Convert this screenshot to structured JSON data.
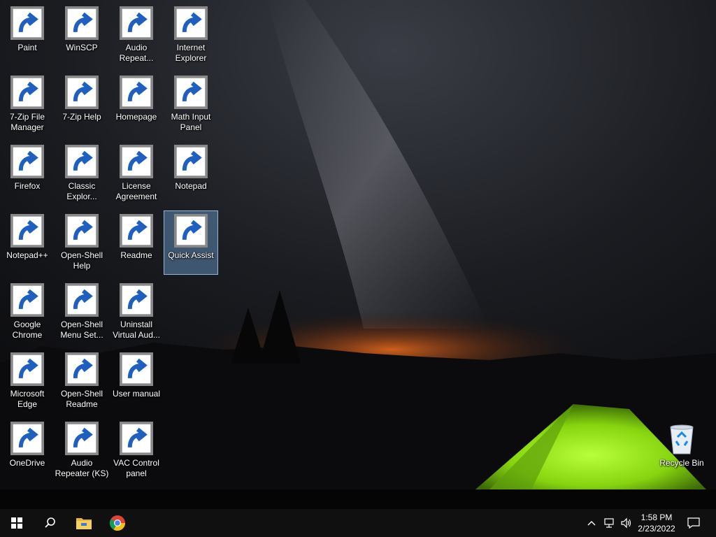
{
  "desktop": {
    "icons": [
      {
        "label": "Paint",
        "icon": "paint-icon"
      },
      {
        "label": "WinSCP",
        "icon": "winscp-icon"
      },
      {
        "label": "Audio\nRepeat...",
        "icon": "audio-repeater-icon"
      },
      {
        "label": "Internet\nExplorer",
        "icon": "internet-explorer-icon"
      },
      {
        "label": "7-Zip File\nManager",
        "icon": "7zip-icon"
      },
      {
        "label": "7-Zip Help",
        "icon": "help-icon"
      },
      {
        "label": "Homepage",
        "icon": "document-icon"
      },
      {
        "label": "Math Input\nPanel",
        "icon": "math-input-icon"
      },
      {
        "label": "Firefox",
        "icon": "firefox-icon"
      },
      {
        "label": "Classic\nExplor...",
        "icon": "shell-icon"
      },
      {
        "label": "License\nAgreement",
        "icon": "text-document-icon"
      },
      {
        "label": "Notepad",
        "icon": "notepad-icon"
      },
      {
        "label": "Notepad++",
        "icon": "notepad-plus-icon"
      },
      {
        "label": "Open-Shell\nHelp",
        "icon": "help-icon"
      },
      {
        "label": "Readme",
        "icon": "text-document-icon"
      },
      {
        "label": "Quick Assist",
        "icon": "quick-assist-icon"
      },
      {
        "label": "Google\nChrome",
        "icon": "chrome-icon"
      },
      {
        "label": "Open-Shell\nMenu Set...",
        "icon": "shell-icon"
      },
      {
        "label": "Uninstall\nVirtual Aud...",
        "icon": "uninstall-icon"
      },
      {
        "label": "Microsoft\nEdge",
        "icon": "edge-icon"
      },
      {
        "label": "Open-Shell\nReadme",
        "icon": "wordpad-doc-icon"
      },
      {
        "label": "User manual",
        "icon": "help-icon"
      },
      {
        "label": "OneDrive",
        "icon": "onedrive-icon"
      },
      {
        "label": "Audio\nRepeater (KS)",
        "icon": "audio-repeater-icon"
      },
      {
        "label": "VAC Control\npanel",
        "icon": "vac-panel-icon"
      },
      {
        "label": "Recycle Bin",
        "icon": "recycle-bin-icon"
      }
    ],
    "selected_label": "Quick Assist"
  },
  "taskbar": {
    "start": "windows-start-icon",
    "search": "search-icon",
    "pinned": [
      "file-explorer-icon",
      "chrome-icon"
    ],
    "tray": [
      "chevron-up-icon",
      "network-icon",
      "volume-icon"
    ],
    "time": "1:58 PM",
    "date": "2/23/2022",
    "notifications": "action-center-icon"
  }
}
